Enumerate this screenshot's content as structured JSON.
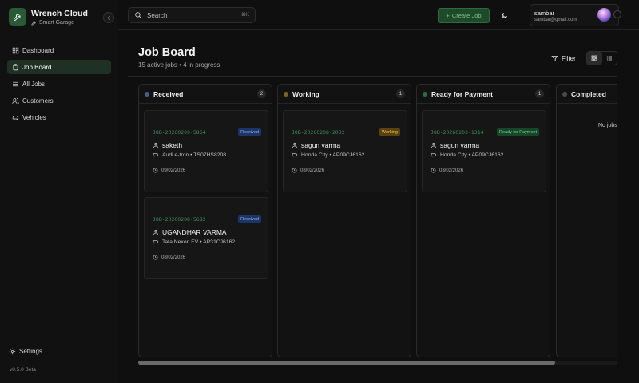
{
  "app": {
    "name": "Wrench Cloud",
    "subtitle": "Smart Garage",
    "version": "v0.5.0 Beta"
  },
  "sidebar": {
    "items": [
      {
        "label": "Dashboard",
        "icon": "dashboard-icon",
        "active": false
      },
      {
        "label": "Job Board",
        "icon": "clipboard-icon",
        "active": true
      },
      {
        "label": "All Jobs",
        "icon": "list-icon",
        "active": false
      },
      {
        "label": "Customers",
        "icon": "users-icon",
        "active": false
      },
      {
        "label": "Vehicles",
        "icon": "car-icon",
        "active": false
      }
    ],
    "settings_label": "Settings"
  },
  "topbar": {
    "search_placeholder": "Search",
    "search_shortcut": "⌘K",
    "create_label": "Create Job",
    "user_name": "sambar",
    "user_email": "sambar@gmail.com"
  },
  "page": {
    "title": "Job Board",
    "subtitle": "15 active jobs • 4 in progress",
    "filter_label": "Filter"
  },
  "columns": [
    {
      "title": "Received",
      "count": "2",
      "dot_color": "#4a5c8a",
      "cards": [
        {
          "job_id": "JOB-20260209-5864",
          "badge": "Received",
          "customer": "saketh",
          "vehicle": "Audi e-tron • TS07HS8208",
          "date": "09/02/2026"
        },
        {
          "job_id": "JOB-20260208-5682",
          "badge": "Received",
          "customer": "UGANDHAR VARMA",
          "vehicle": "Tata Nexon EV • AP31CJ6162",
          "date": "08/02/2026"
        }
      ]
    },
    {
      "title": "Working",
      "count": "1",
      "dot_color": "#7a6420",
      "cards": [
        {
          "job_id": "JOB-20260208-2032",
          "badge": "Working",
          "customer": "sagun varma",
          "vehicle": "Honda City • AP09CJ6162",
          "date": "08/02/2026"
        }
      ]
    },
    {
      "title": "Ready for Payment",
      "count": "1",
      "dot_color": "#2f6a3e",
      "cards": [
        {
          "job_id": "JOB-20260203-1314",
          "badge": "Ready for Payment",
          "customer": "sagun varma",
          "vehicle": "Honda City • AP09CJ6162",
          "date": "03/02/2026"
        }
      ]
    },
    {
      "title": "Completed",
      "count": "",
      "dot_color": "#4a4a4a",
      "empty_text": "No jobs",
      "cards": []
    }
  ],
  "colors": {
    "accent": "#2d6b3c",
    "badge_received_bg": "#1c3566",
    "badge_received_fg": "#8fb3f0",
    "badge_working_bg": "#5a4210",
    "badge_working_fg": "#f0c24f",
    "badge_ready_bg": "#17452a",
    "badge_ready_fg": "#6fd890"
  },
  "scroll": {
    "horizontal_position": 0.0,
    "visible_fraction": 0.87
  }
}
